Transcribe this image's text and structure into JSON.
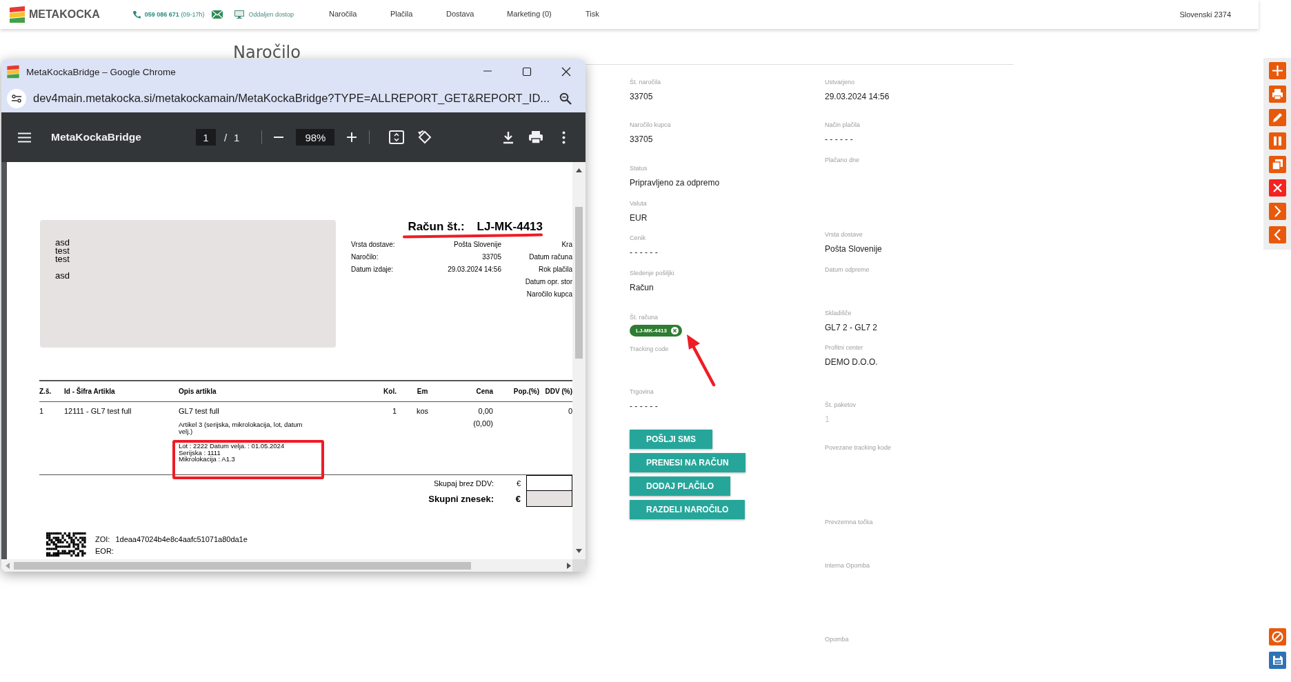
{
  "top_bar": {
    "logo": "METAKOCKA",
    "phone": "**059 086 671** (09-17h)",
    "remote_access": "Oddaljen dostop",
    "nav": [
      {
        "label": "Naročila",
        "selected": false
      },
      {
        "label": "Plačila",
        "selected": false
      },
      {
        "label": "Dostava",
        "selected": false
      },
      {
        "label": "Marketing (0)",
        "selected": false
      },
      {
        "label": "Tisk",
        "selected": false
      }
    ],
    "user": "Slovenski 2374"
  },
  "page_title": "Naročilo",
  "browser_window": {
    "title": "MetaKockaBridge – Google Chrome",
    "url": "dev4main.metakocka.si/metakockamain/MetaKockaBridge?TYPE=ALLREPORT_GET&REPORT_ID...",
    "viewer": {
      "title": "MetaKockaBridge",
      "page": "1",
      "page_separator": "/",
      "page_count": "1",
      "zoom": "98%"
    },
    "document": {
      "address_blocks": [
        [
          "asd",
          "test",
          "test"
        ],
        [
          "asd"
        ]
      ],
      "invoice_label": "Račun št.:",
      "invoice_number": "LJ-MK-4413",
      "info": [
        {
          "label": "Vrsta dostave:",
          "value": "Pošta Slovenije"
        },
        {
          "label": "Naročilo:",
          "value": "33705"
        },
        {
          "label": "Datum izdaje:",
          "value": "29.03.2024 14:56"
        }
      ],
      "info_right": [
        "Kra",
        "Datum računa",
        "Rok plačila",
        "Datum opr. stor",
        "Naročilo kupca"
      ],
      "columns": [
        "Z.š.",
        "Id - Šifra Artikla",
        "Opis artikla",
        "Kol.",
        "Em",
        "Cena",
        "Pop.(%)",
        "DDV (%)"
      ],
      "rows": [
        {
          "number": "1",
          "article": "12111 - GL7 test full",
          "description": "GL7 test full",
          "quantity": "1",
          "unit": "kos",
          "price": "0,00",
          "vat": "0",
          "note": "Artikel 3 (serijska, mikrolokacija, lot, datum velj.)",
          "price_note": "(0,00)",
          "details": [
            "Lot : 2222 Datum velja. : 01.05.2024",
            "Serijska : 1111",
            "Mikrolokacija : A1.3"
          ]
        }
      ],
      "totals": [
        {
          "kind": "subtotal",
          "label": "Skupaj brez DDV:",
          "currency": "€"
        },
        {
          "kind": "total",
          "label": "Skupni znesek:",
          "currency": "€"
        }
      ],
      "zoi_label": "ZOI:",
      "zoi": "1deaa47024b4e8c4aafc51071a80da1e",
      "eor_label": "EOR:"
    }
  },
  "details": {
    "left": [
      {
        "label": "Št. naročila",
        "kind": "text",
        "value": "33705"
      },
      {
        "label": "Naročilo kupca",
        "kind": "text",
        "value": "33705"
      },
      {
        "label": "Status",
        "kind": "text",
        "value": "Pripravljeno za odpremo"
      },
      {
        "label": "Valuta",
        "kind": "text",
        "value": "EUR"
      },
      {
        "label": "Cenik",
        "kind": "text",
        "value": "- - - - - -"
      },
      {
        "label": "Sledenje pošiljki",
        "kind": "text",
        "value": "Račun"
      },
      {
        "label": "Št. računa",
        "kind": "chip",
        "value": "LJ-MK-4413"
      },
      {
        "label": "Tracking code"
      },
      {
        "label": "Trgovina",
        "kind": "text",
        "value": "- - - - - -"
      }
    ],
    "right": [
      {
        "label": "Ustvarjeno",
        "kind": "text",
        "value": "29.03.2024 14:56"
      },
      {
        "label": "Način plačila",
        "kind": "text",
        "value": "- - - - - -"
      },
      {
        "label": "Plačano dne"
      },
      {
        "label": "Vrsta dostave",
        "kind": "text",
        "value": "Pošta Slovenije"
      },
      {
        "label": "Datum odpreme"
      },
      {
        "label": "Skladišče",
        "kind": "text",
        "value": "GL7 2 - GL7 2"
      },
      {
        "label": "Profitni center",
        "kind": "text",
        "value": "DEMO D.O.O."
      },
      {
        "label": "Št. paketov",
        "kind": "muted",
        "value": "1"
      },
      {
        "label": "Povezane tracking kode"
      },
      {
        "label": "Prevzemna točka"
      },
      {
        "label": "Interna Opomba"
      },
      {
        "label": "Opomba"
      }
    ],
    "buttons": [
      "POŠLJI SMS",
      "PRENESI NA RAČUN",
      "DODAJ PLAČILO",
      "RAZDELI NAROČILO"
    ]
  }
}
